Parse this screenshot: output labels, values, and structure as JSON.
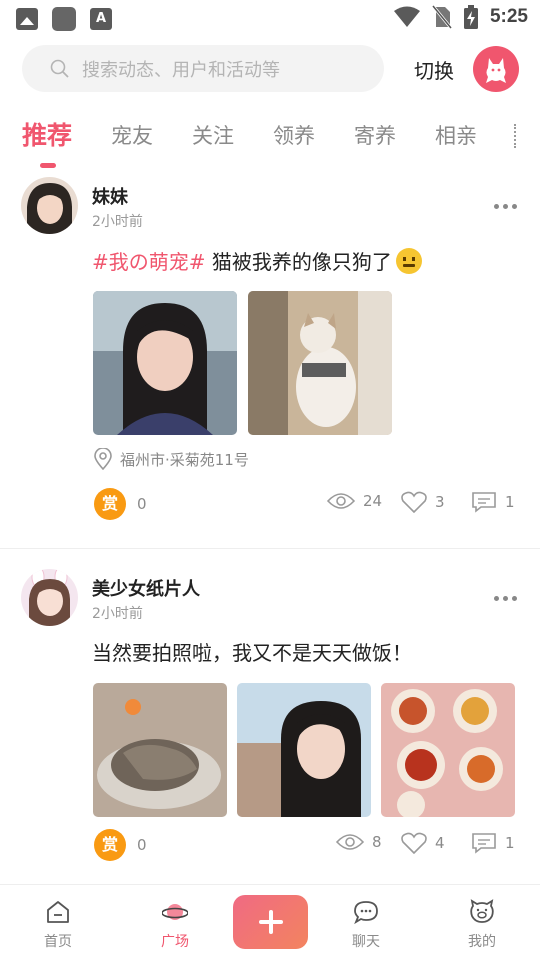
{
  "status_bar": {
    "time": "5:25",
    "icons": [
      "photo-icon",
      "app-icon",
      "a-icon",
      "wifi-icon",
      "no-sim-icon",
      "battery-charging-icon"
    ]
  },
  "header": {
    "search_placeholder": "搜索动态、用户和活动等",
    "switch_label": "切换",
    "logo_icon": "cat-logo-icon"
  },
  "tabs": [
    {
      "label": "推荐",
      "active": true
    },
    {
      "label": "宠友"
    },
    {
      "label": "关注"
    },
    {
      "label": "领养"
    },
    {
      "label": "寄养"
    },
    {
      "label": "相亲"
    }
  ],
  "posts": [
    {
      "user": "妹妹",
      "time": "2小时前",
      "tag": "#我の萌宠#",
      "text": " 猫被我养的像只狗了",
      "location": "福州市·采菊苑11号",
      "reward_label": "赏",
      "reward_count": "0",
      "views": "24",
      "likes": "3",
      "comments": "1"
    },
    {
      "user": "美少女纸片人",
      "time": "2小时前",
      "text": "当然要拍照啦，我又不是天天做饭！",
      "reward_label": "赏",
      "reward_count": "0",
      "views": "8",
      "likes": "4",
      "comments": "1"
    }
  ],
  "bottom_nav": [
    {
      "label": "首页",
      "icon": "home-icon"
    },
    {
      "label": "广场",
      "icon": "planet-icon",
      "active": true
    },
    {
      "label": "聊天",
      "icon": "chat-icon"
    },
    {
      "label": "我的",
      "icon": "pig-icon"
    }
  ],
  "colors": {
    "accent": "#f0566e",
    "reward": "#f99a12",
    "muted": "#8a8a8a"
  }
}
